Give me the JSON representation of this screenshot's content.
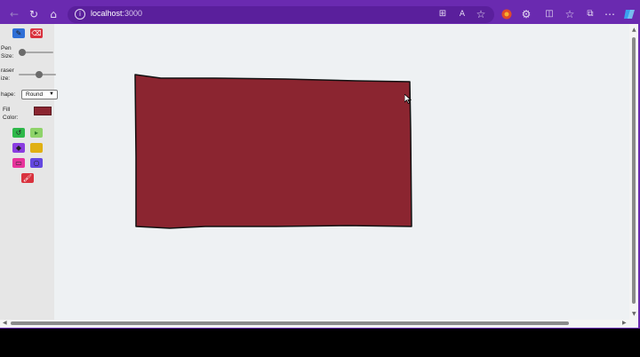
{
  "browser": {
    "address_host": "localhost",
    "address_port": ":3000",
    "icons": [
      "back-icon",
      "refresh-icon",
      "home-icon",
      "info-icon",
      "split-view-icon",
      "read-aloud-icon",
      "favorite-star-icon",
      "profile-icon",
      "extensions-icon",
      "split-screen-icon",
      "favorites-icon",
      "collections-icon",
      "more-icon",
      "copilot-icon"
    ]
  },
  "sidebar": {
    "pen_size_label": "Pen\nSize:",
    "pen_size_value": 0.1,
    "eraser_size_label": "raser\nize:",
    "eraser_size_value": 0.55,
    "shape_label": "hape:",
    "shape_selected": "Round",
    "fill_color_label": "Fill\nColor:",
    "fill_color": "#8b2530",
    "tool_colors": {
      "pen": "#2f6fd6",
      "eraser": "#d9323e",
      "undo": "#2eb84a",
      "redo": "#8fd36a",
      "fill": "#8a3de0",
      "yellow": "#e0b012",
      "rectangle": "#e8349c",
      "circle": "#6448e0",
      "clear": "#d9323e"
    }
  },
  "canvas": {
    "shape_fill": "#8b2530",
    "shape_stroke": "#111111"
  }
}
